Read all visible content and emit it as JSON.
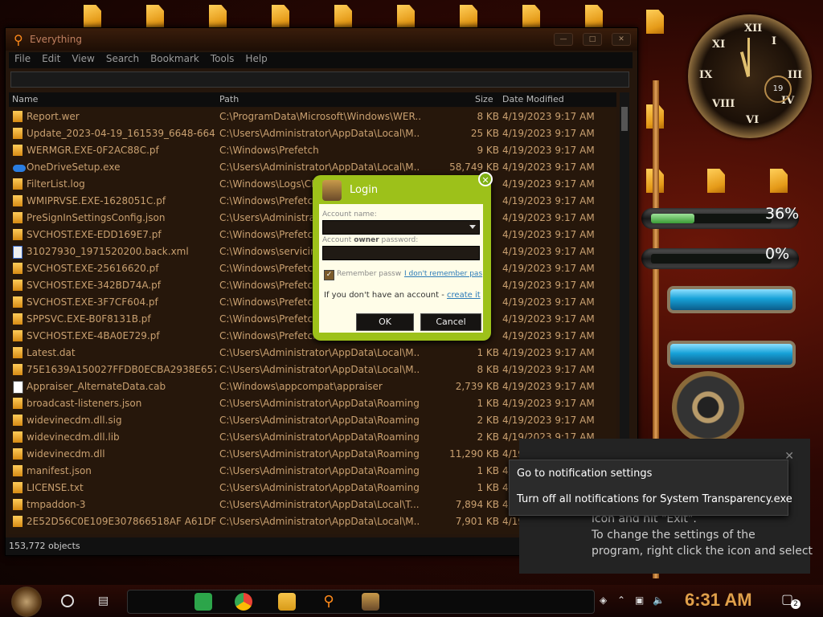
{
  "everything": {
    "title": "Everything",
    "menu": [
      "File",
      "Edit",
      "View",
      "Search",
      "Bookmark",
      "Tools",
      "Help"
    ],
    "columns": {
      "name": "Name",
      "path": "Path",
      "size": "Size",
      "date": "Date Modified"
    },
    "rows": [
      {
        "icon": "file-icon",
        "name": "Report.wer",
        "path": "C:\\ProgramData\\Microsoft\\Windows\\WER...",
        "size": "8 KB",
        "date": "4/19/2023 9:17 AM"
      },
      {
        "icon": "file-icon",
        "name": "Update_2023-04-19_161539_6648-664...",
        "path": "C:\\Users\\Administrator\\AppData\\Local\\M...",
        "size": "25 KB",
        "date": "4/19/2023 9:17 AM"
      },
      {
        "icon": "file-icon",
        "name": "WERMGR.EXE-0F2AC88C.pf",
        "path": "C:\\Windows\\Prefetch",
        "size": "9 KB",
        "date": "4/19/2023 9:17 AM"
      },
      {
        "icon": "onedrive-icon",
        "name": "OneDriveSetup.exe",
        "path": "C:\\Users\\Administrator\\AppData\\Local\\M...",
        "size": "58,749 KB",
        "date": "4/19/2023 9:17 AM"
      },
      {
        "icon": "file-icon",
        "name": "FilterList.log",
        "path": "C:\\Windows\\Logs\\CB",
        "size": "",
        "date": "4/19/2023 9:17 AM"
      },
      {
        "icon": "file-icon",
        "name": "WMIPRVSE.EXE-1628051C.pf",
        "path": "C:\\Windows\\Prefetch",
        "size": "",
        "date": "4/19/2023 9:17 AM"
      },
      {
        "icon": "file-icon",
        "name": "PreSignInSettingsConfig.json",
        "path": "C:\\Users\\Administrat",
        "size": "",
        "date": "4/19/2023 9:17 AM"
      },
      {
        "icon": "file-icon",
        "name": "SVCHOST.EXE-EDD169E7.pf",
        "path": "C:\\Windows\\Prefetch",
        "size": "",
        "date": "4/19/2023 9:17 AM"
      },
      {
        "icon": "xml-icon",
        "name": "31027930_1971520200.back.xml",
        "path": "C:\\Windows\\servicing",
        "size": "",
        "date": "4/19/2023 9:17 AM"
      },
      {
        "icon": "file-icon",
        "name": "SVCHOST.EXE-25616620.pf",
        "path": "C:\\Windows\\Prefetch",
        "size": "",
        "date": "4/19/2023 9:17 AM"
      },
      {
        "icon": "file-icon",
        "name": "SVCHOST.EXE-342BD74A.pf",
        "path": "C:\\Windows\\Prefetch",
        "size": "",
        "date": "4/19/2023 9:17 AM"
      },
      {
        "icon": "file-icon",
        "name": "SVCHOST.EXE-3F7CF604.pf",
        "path": "C:\\Windows\\Prefetch",
        "size": "",
        "date": "4/19/2023 9:17 AM"
      },
      {
        "icon": "file-icon",
        "name": "SPPSVC.EXE-B0F8131B.pf",
        "path": "C:\\Windows\\Prefetch",
        "size": "",
        "date": "4/19/2023 9:17 AM"
      },
      {
        "icon": "file-icon",
        "name": "SVCHOST.EXE-4BA0E729.pf",
        "path": "C:\\Windows\\Prefetch",
        "size": "",
        "date": "4/19/2023 9:17 AM"
      },
      {
        "icon": "file-icon",
        "name": "Latest.dat",
        "path": "C:\\Users\\Administrator\\AppData\\Local\\M...",
        "size": "1 KB",
        "date": "4/19/2023 9:17 AM"
      },
      {
        "icon": "file-icon",
        "name": "75E1639A150027FFDB0ECBA2938E657...",
        "path": "C:\\Users\\Administrator\\AppData\\Local\\M...",
        "size": "8 KB",
        "date": "4/19/2023 9:17 AM"
      },
      {
        "icon": "cab-icon",
        "name": "Appraiser_AlternateData.cab",
        "path": "C:\\Windows\\appcompat\\appraiser",
        "size": "2,739 KB",
        "date": "4/19/2023 9:17 AM"
      },
      {
        "icon": "file-icon",
        "name": "broadcast-listeners.json",
        "path": "C:\\Users\\Administrator\\AppData\\Roaming...",
        "size": "1 KB",
        "date": "4/19/2023 9:17 AM"
      },
      {
        "icon": "file-icon",
        "name": "widevinecdm.dll.sig",
        "path": "C:\\Users\\Administrator\\AppData\\Roaming...",
        "size": "2 KB",
        "date": "4/19/2023 9:17 AM"
      },
      {
        "icon": "file-icon",
        "name": "widevinecdm.dll.lib",
        "path": "C:\\Users\\Administrator\\AppData\\Roaming...",
        "size": "2 KB",
        "date": "4/19/2023 9:17 AM"
      },
      {
        "icon": "file-icon",
        "name": "widevinecdm.dll",
        "path": "C:\\Users\\Administrator\\AppData\\Roaming...",
        "size": "11,290 KB",
        "date": "4/19/2023 9:17 AM"
      },
      {
        "icon": "file-icon",
        "name": "manifest.json",
        "path": "C:\\Users\\Administrator\\AppData\\Roaming...",
        "size": "1 KB",
        "date": "4/19/2023 9:17 AM"
      },
      {
        "icon": "file-icon",
        "name": "LICENSE.txt",
        "path": "C:\\Users\\Administrator\\AppData\\Roaming...",
        "size": "1 KB",
        "date": "4/19/2023 9:17 AM"
      },
      {
        "icon": "file-icon",
        "name": "tmpaddon-3",
        "path": "C:\\Users\\Administrator\\AppData\\Local\\T...",
        "size": "7,894 KB",
        "date": "4/19/2023 9:17 AM"
      },
      {
        "icon": "file-icon",
        "name": "2E52D56C0E109E307866518AF A61DF9...",
        "path": "C:\\Users\\Administrator\\AppData\\Local\\M...",
        "size": "7,901 KB",
        "date": "4/19/2023 9:17 AM"
      }
    ],
    "status": "153,772 objects"
  },
  "login": {
    "title": "Login",
    "account_label": "Account name:",
    "password_label_pre": "Account ",
    "password_label_bold": "owner",
    "password_label_post": " password:",
    "remember": "Remember passw",
    "forgot": "I don't remember pas",
    "no_account": "If you don't have an account - ",
    "create": "create it",
    "ok": "OK",
    "cancel": "Cancel",
    "remember_checked": true
  },
  "gadgets": {
    "cpu_percent": "36%",
    "ram_percent": "0%",
    "cpu_level": 0.36,
    "ram_level": 0.0,
    "clock_day": "19"
  },
  "toast": {
    "line1": "icon and hit \"Exit\".",
    "line2": "To change the settings of the",
    "line3": "program, right click the icon and select"
  },
  "context_menu": {
    "item1": "Go to notification settings",
    "item2": "Turn off all notifications for System Transparency.exe"
  },
  "taskbar": {
    "time": "6:31 AM",
    "notification_count": "2"
  }
}
